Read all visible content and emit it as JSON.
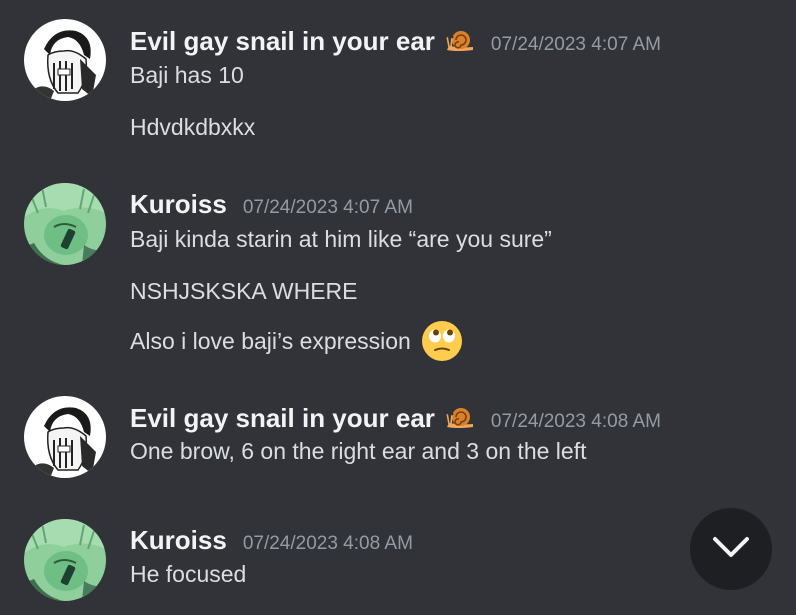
{
  "messages": [
    {
      "author": "Evil gay snail in your ear",
      "timestamp": "07/24/2023 4:07 AM",
      "lines": [
        "Baji has 10",
        "Hdvdkdbxkx"
      ]
    },
    {
      "author": "Kuroiss",
      "timestamp": "07/24/2023 4:07 AM",
      "lines": [
        "Baji kinda starin at him like “are you sure”",
        "NSHJSKSKA WHERE",
        "Also i love baji’s expression"
      ]
    },
    {
      "author": "Evil gay snail in your ear",
      "timestamp": "07/24/2023 4:08 AM",
      "lines": [
        "One brow, 6 on the right ear and 3 on the left"
      ]
    },
    {
      "author": "Kuroiss",
      "timestamp": "07/24/2023 4:08 AM",
      "lines": [
        "He focused"
      ]
    }
  ],
  "icons": {
    "author_badge": "snail-icon",
    "reaction_emoji": "face-with-rolling-eyes-icon",
    "scroll_button": "chevron-down-icon"
  },
  "colors": {
    "background": "#313338",
    "author": "#f2f3f5",
    "timestamp": "#949ba4",
    "text": "#dbdee1",
    "scroll_button": "#1e1f22"
  }
}
